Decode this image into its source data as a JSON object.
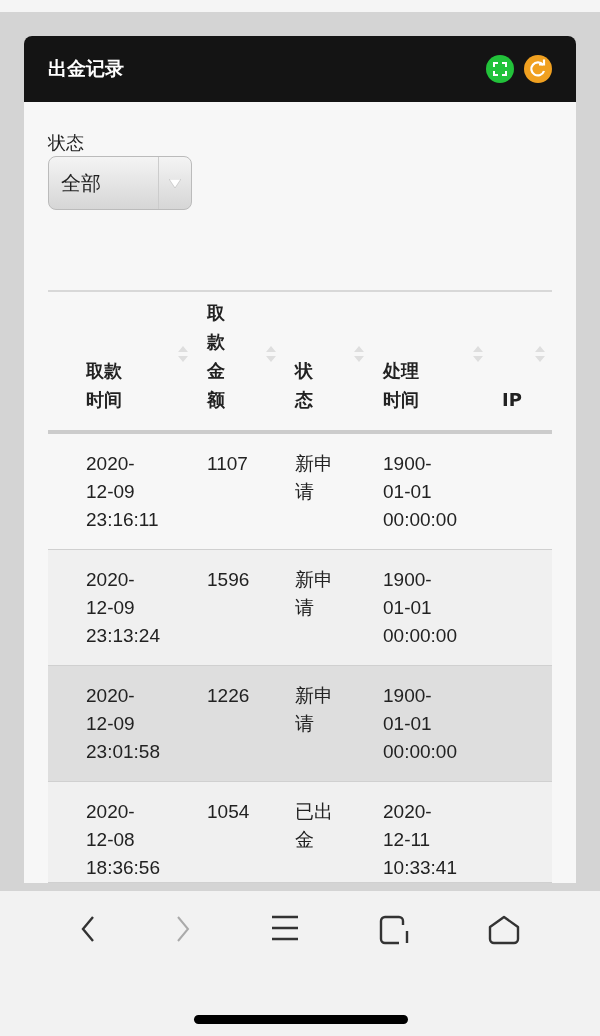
{
  "panel": {
    "title": "出金记录"
  },
  "filter": {
    "label": "状态",
    "value": "全部"
  },
  "table": {
    "columns": [
      "取款时间",
      "取款金额",
      "状态",
      "处理时间",
      "IP"
    ],
    "rows": [
      {
        "cells": [
          "2020-12-09 23:16:11",
          "1107",
          "新申请",
          "1900-01-01 00:00:00",
          ""
        ],
        "selected": false
      },
      {
        "cells": [
          "2020-12-09 23:13:24",
          "1596",
          "新申请",
          "1900-01-01 00:00:00",
          ""
        ],
        "selected": false
      },
      {
        "cells": [
          "2020-12-09 23:01:58",
          "1226",
          "新申请",
          "1900-01-01 00:00:00",
          ""
        ],
        "selected": true
      },
      {
        "cells": [
          "2020-12-08 18:36:56",
          "1054",
          "已出金",
          "2020-12-11 10:33:41",
          ""
        ],
        "selected": false
      }
    ]
  }
}
